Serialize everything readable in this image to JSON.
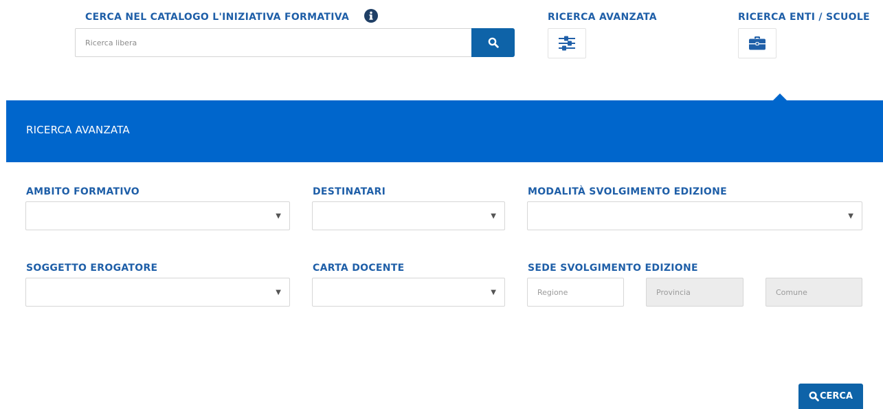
{
  "header": {
    "catalog_label": "CERCA NEL CATALOGO L'INIZIATIVA FORMATIVA",
    "search_placeholder": "Ricerca libera",
    "advanced_label": "RICERCA AVANZATA",
    "entities_label": "RICERCA ENTI / SCUOLE"
  },
  "panel": {
    "title": "RICERCA AVANZATA"
  },
  "fields": {
    "ambito_label": "AMBITO FORMATIVO",
    "destinatari_label": "DESTINATARI",
    "modalita_label": "MODALITÀ SVOLGIMENTO EDIZIONE",
    "soggetto_label": "SOGGETTO EROGATORE",
    "carta_label": "CARTA DOCENTE",
    "sede_label": "SEDE SVOLGIMENTO EDIZIONE",
    "regione_placeholder": "Regione",
    "provincia_placeholder": "Provincia",
    "comune_placeholder": "Comune",
    "dropdown_arrow": "▼"
  },
  "actions": {
    "cerca_label": "CERCA"
  },
  "colors": {
    "accent": "#0066cc",
    "button": "#0e63a8",
    "label": "#1f5fa8"
  }
}
